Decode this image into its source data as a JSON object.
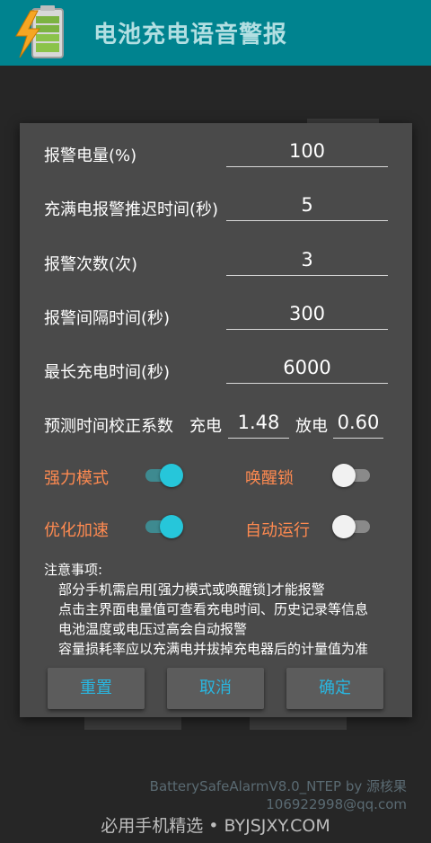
{
  "app": {
    "title": "电池充电语音警报",
    "icon": "battery-charging-icon"
  },
  "dialog": {
    "fields": [
      {
        "label": "报警电量(%)",
        "value": "100"
      },
      {
        "label": "充满电报警推迟时间(秒)",
        "value": "5"
      },
      {
        "label": "报警次数(次)",
        "value": "3"
      },
      {
        "label": "报警间隔时间(秒)",
        "value": "300"
      },
      {
        "label": "最长充电时间(秒)",
        "value": "6000"
      }
    ],
    "prediction": {
      "label": "预测时间校正系数",
      "charge_label": "充电",
      "charge_value": "1.48",
      "discharge_label": "放电",
      "discharge_value": "0.60"
    },
    "toggles": {
      "strong_mode": {
        "label": "强力模式",
        "on": true
      },
      "wake_lock": {
        "label": "唤醒锁",
        "on": false
      },
      "optimize_speed": {
        "label": "优化加速",
        "on": true
      },
      "auto_run": {
        "label": "自动运行",
        "on": false
      }
    },
    "notes": {
      "title": "注意事项:",
      "items": [
        "部分手机需启用[强力模式或唤醒锁]才能报警",
        "点击主界面电量值可查看充电时间、历史记录等信息",
        "电池温度或电压过高会自动报警",
        "容量损耗率应以充满电并拔掉充电器后的计量值为准"
      ]
    },
    "buttons": {
      "reset": "重置",
      "cancel": "取消",
      "ok": "确定"
    }
  },
  "footer": {
    "version": "BatterySafeAlarmV8.0_NTEP by 源核果",
    "email": "106922998@qq.com",
    "watermark": "必用手机精选 • BYJSJXY.COM"
  },
  "colors": {
    "appbar": "#00838f",
    "accent": "#26c6da",
    "toggle_label": "#ff8a50",
    "button_text": "#29b6e0"
  }
}
